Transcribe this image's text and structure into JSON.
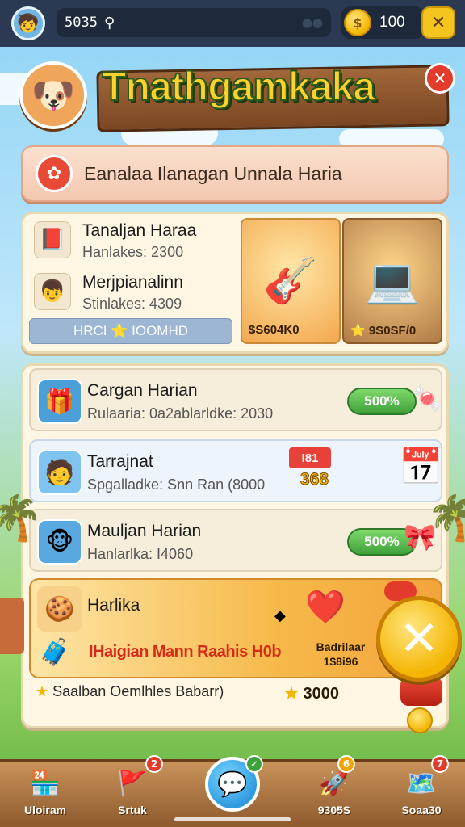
{
  "topbar": {
    "search_value": "5035",
    "coins": "100",
    "close_label": "✕"
  },
  "header": {
    "title": "Tnathgamkaka",
    "close_label": "✕"
  },
  "daily": {
    "text": "Eanalaa Ilanagan Unnala Haria"
  },
  "featured": {
    "items": [
      {
        "title": "Tanaljan Haraa",
        "sub": "Hanlakes: 2300"
      },
      {
        "title": "Merjpianalinn",
        "sub": "Stinlakes: 4309"
      }
    ],
    "stat_pill": "HRCI ⭐ IOOMHD",
    "scenes": [
      {
        "price": "$S604K0"
      },
      {
        "price": "⭐ 9S0SF/0"
      }
    ]
  },
  "list": {
    "rows": [
      {
        "title": "Cargan Harian",
        "sub": "Rulaaria: 0a2ablarldke: 2030",
        "badge": "500%"
      },
      {
        "title": "Tarrajnat",
        "sub": "Spgalladke: Snn Ran (8000",
        "ticket_top": "I81",
        "ticket_bottom": "368"
      },
      {
        "title": "Mauljan Harian",
        "sub": "Hanlarlka: I4060",
        "badge": "500%"
      }
    ],
    "special": {
      "title": "Harlika",
      "promo": "IHaigian Mann Raahis H0b",
      "bonus_line1": "Badrilaar",
      "bonus_line2": "1$8i96"
    },
    "footer_text": "Saalban Oemlhles Babarr)",
    "footer_value": "3000"
  },
  "nav": {
    "items": [
      {
        "label": "Uloiram",
        "badge": ""
      },
      {
        "label": "Srtuk",
        "badge": "2"
      },
      {
        "label": "",
        "badge": "✓"
      },
      {
        "label": "9305S",
        "badge": "6"
      },
      {
        "label": "Soaa30",
        "badge": "7"
      }
    ]
  },
  "colors": {
    "topbar": "#2b3a52",
    "accent_gold": "#f4c51f",
    "green_pill": "#3ea23a",
    "promo_red": "#d82a1a"
  }
}
